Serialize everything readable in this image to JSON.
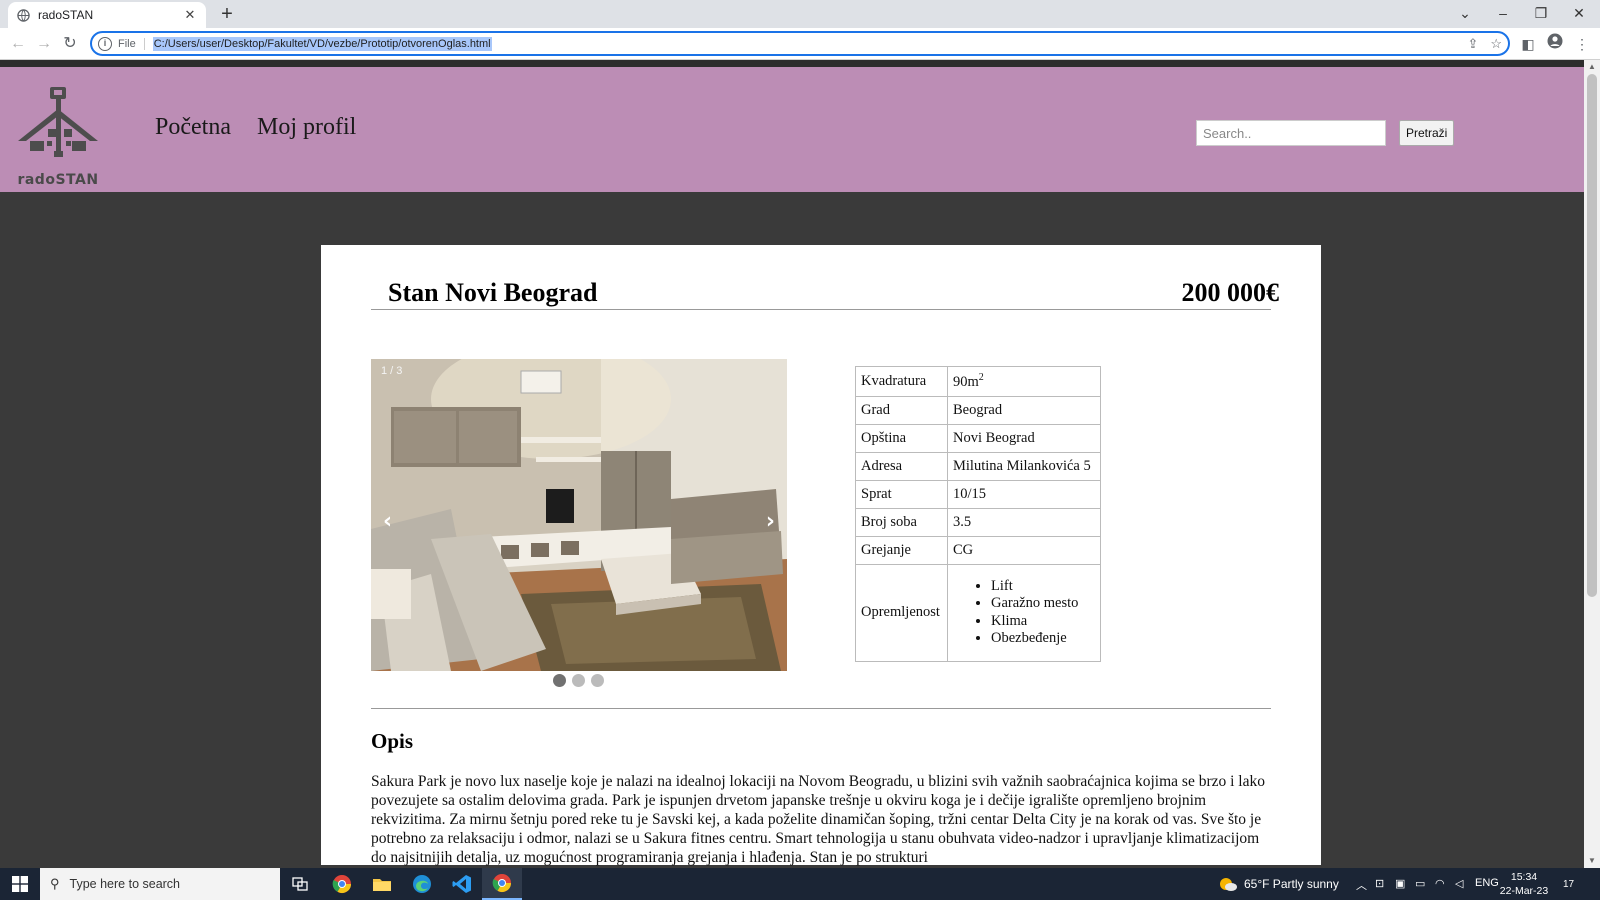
{
  "browser": {
    "tab_title": "radoSTAN",
    "new_tab": "+",
    "url_scheme": "File",
    "url": "C:/Users/user/Desktop/Fakultet/VD/vezbe/Prototip/otvorenOglas.html"
  },
  "header": {
    "logo_text": "radoSTAN",
    "nav": [
      "Početna",
      "Moj profil"
    ],
    "search_placeholder": "Search..",
    "search_button": "Pretraži",
    "bg_color": "#bc8db5"
  },
  "listing": {
    "title": "Stan Novi Beograd",
    "price": "200 000€",
    "carousel": {
      "counter": "1 / 3",
      "prev": "‹",
      "next": "›",
      "slides": 3,
      "active_slide": 1
    },
    "specs": [
      {
        "key": "Kvadratura",
        "value": "90m",
        "sup": "2"
      },
      {
        "key": "Grad",
        "value": "Beograd"
      },
      {
        "key": "Opština",
        "value": "Novi Beograd"
      },
      {
        "key": "Adresa",
        "value": "Milutina Milankovića 5"
      },
      {
        "key": "Sprat",
        "value": "10/15"
      },
      {
        "key": "Broj soba",
        "value": "3.5"
      },
      {
        "key": "Grejanje",
        "value": "CG"
      }
    ],
    "equipment": {
      "key": "Opremljenost",
      "items": [
        "Lift",
        "Garažno mesto",
        "Klima",
        "Obezbeđenje"
      ]
    },
    "description_title": "Opis",
    "description": "Sakura Park je novo lux naselje koje je nalazi na idealnoj lokaciji na Novom Beogradu, u blizini svih važnih saobraćajnica kojima se brzo i lako povezujete sa ostalim delovima grada. Park je ispunjen drvetom japanske trešnje u okviru koga je i dečije igralište opremljeno brojnim rekvizitima. Za mirnu šetnju pored reke tu je Savski kej, a kada poželite dinamičan šoping, tržni centar Delta City je na korak od vas. Sve što je potrebno za relaksaciju i odmor, nalazi se u Sakura fitnes centru. Smart tehnologija u stanu obuhvata video-nadzor i upravljanje klimatizacijom do najsitnijih detalja, uz mogućnost programiranja grejanja i hlađenja. Stan je po strukturi"
  },
  "taskbar": {
    "search_placeholder": "Type here to search",
    "weather": "65°F  Partly sunny",
    "lang": "ENG",
    "time": "15:34",
    "date": "22-Mar-23",
    "notifications": "17"
  }
}
